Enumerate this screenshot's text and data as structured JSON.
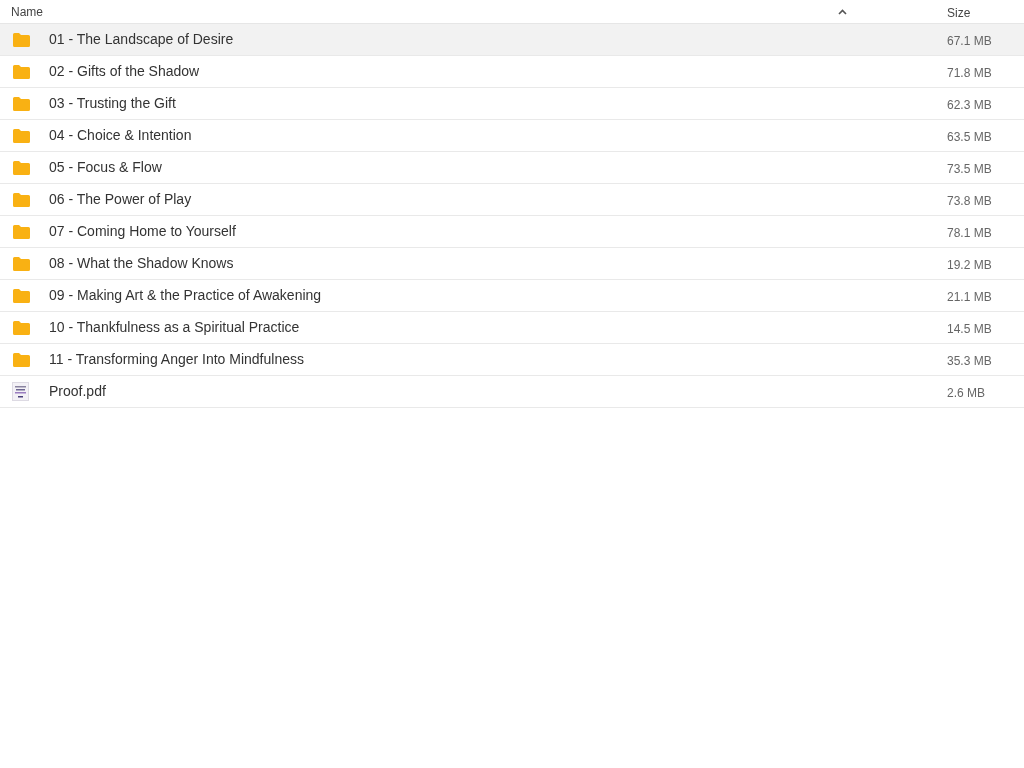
{
  "columns": [
    {
      "label": "Name",
      "sorted": true
    },
    {
      "label": "Size",
      "sorted": false
    }
  ],
  "rows": [
    {
      "kind": "folder",
      "name": "01 - The Landscape of Desire",
      "size": "67.1 MB",
      "selected": true
    },
    {
      "kind": "folder",
      "name": "02 - Gifts of the Shadow",
      "size": "71.8 MB",
      "selected": false
    },
    {
      "kind": "folder",
      "name": "03 - Trusting the Gift",
      "size": "62.3 MB",
      "selected": false
    },
    {
      "kind": "folder",
      "name": "04 - Choice & Intention",
      "size": "63.5 MB",
      "selected": false
    },
    {
      "kind": "folder",
      "name": "05 - Focus & Flow",
      "size": "73.5 MB",
      "selected": false
    },
    {
      "kind": "folder",
      "name": "06 - The Power of Play",
      "size": "73.8 MB",
      "selected": false
    },
    {
      "kind": "folder",
      "name": "07 - Coming Home to Yourself",
      "size": "78.1 MB",
      "selected": false
    },
    {
      "kind": "folder",
      "name": "08 - What the Shadow Knows",
      "size": "19.2 MB",
      "selected": false
    },
    {
      "kind": "folder",
      "name": "09 - Making Art & the Practice of Awakening",
      "size": "21.1 MB",
      "selected": false
    },
    {
      "kind": "folder",
      "name": "10 - Thankfulness as a Spiritual Practice",
      "size": "14.5 MB",
      "selected": false
    },
    {
      "kind": "folder",
      "name": "11 - Transforming Anger Into Mindfulness",
      "size": "35.3 MB",
      "selected": false
    },
    {
      "kind": "pdf",
      "name": "Proof.pdf",
      "size": "2.6 MB",
      "selected": false
    }
  ]
}
